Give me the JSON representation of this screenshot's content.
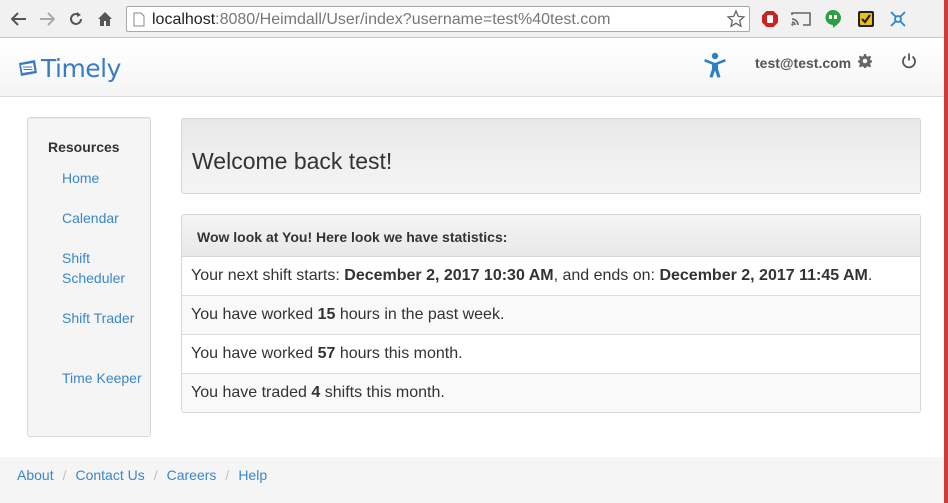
{
  "browser": {
    "url_host": "localhost",
    "url_path": ":8080/Heimdall/User/index?username=test%40test.com"
  },
  "header": {
    "logo_text": "Timely",
    "user_email": "test@test.com"
  },
  "sidebar": {
    "heading": "Resources",
    "items": [
      {
        "label": "Home"
      },
      {
        "label": "Calendar"
      },
      {
        "label": "Shift Scheduler"
      },
      {
        "label": "Shift Trader"
      },
      {
        "label": "Time Keeper"
      }
    ]
  },
  "welcome": {
    "title": "Welcome back test!"
  },
  "stats": {
    "heading": "Wow look at You! Here look we have statistics:",
    "next_shift": {
      "prefix": "Your next shift starts: ",
      "start": "December 2, 2017 10:30 AM",
      "middle": ", and ends on: ",
      "end": "December 2, 2017 11:45 AM",
      "suffix": "."
    },
    "week_hours": {
      "prefix": "You have worked ",
      "value": "15",
      "suffix": " hours in the past week."
    },
    "month_hours": {
      "prefix": "You have worked ",
      "value": "57",
      "suffix": " hours this month."
    },
    "traded": {
      "prefix": "You have traded ",
      "value": "4",
      "suffix": " shifts this month."
    }
  },
  "footer": {
    "links": [
      {
        "label": "About"
      },
      {
        "label": "Contact Us"
      },
      {
        "label": "Careers"
      },
      {
        "label": "Help"
      }
    ],
    "separator": "/"
  },
  "colors": {
    "link": "#3a87c8",
    "brand": "#3a7cc2",
    "browser_accent": "#cf3b3b"
  }
}
